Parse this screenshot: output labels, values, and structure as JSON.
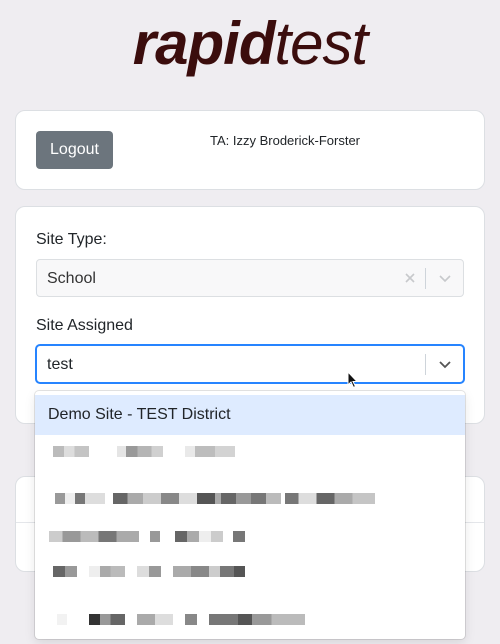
{
  "logo": {
    "bold": "rapid",
    "light": "test"
  },
  "header_card": {
    "logout_label": "Logout",
    "ta_text": "TA: Izzy Broderick-Forster"
  },
  "form": {
    "site_type_label": "Site Type:",
    "site_type_value": "School",
    "site_assigned_label": "Site Assigned",
    "site_assigned_input": "test"
  },
  "dropdown": {
    "focused_option": "Demo Site - TEST District",
    "redacted_options": 5
  },
  "icons": {
    "clear": "close-icon",
    "chevron": "chevron-down-icon",
    "cursor": "mouse-pointer-icon"
  },
  "colors": {
    "logo": "#3b0d0d",
    "logout_button": "#6c757d",
    "focus_border": "#2684ff",
    "option_highlight": "#deebff",
    "background": "#efedf1"
  }
}
